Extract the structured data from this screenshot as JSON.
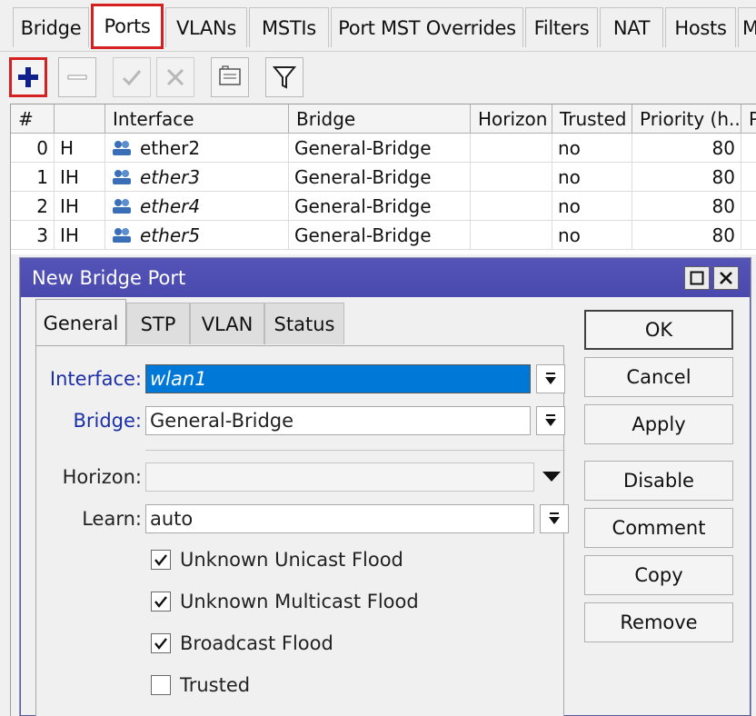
{
  "tabs": [
    "Bridge",
    "Ports",
    "VLANs",
    "MSTIs",
    "Port MST Overrides",
    "Filters",
    "NAT",
    "Hosts",
    "M"
  ],
  "active_tab": "Ports",
  "toolbar": {
    "icons": [
      "plus-icon",
      "minus-icon",
      "check-icon",
      "cross-icon",
      "note-icon",
      "filter-icon"
    ]
  },
  "table": {
    "headers": [
      "#",
      "",
      "Interface",
      "Bridge",
      "Horizon",
      "Trusted",
      "Priority (h...",
      "P"
    ],
    "rows": [
      {
        "num": "0",
        "flags": "H",
        "interface": "ether2",
        "bridge": "General-Bridge",
        "horizon": "",
        "trusted": "no",
        "priority": "80"
      },
      {
        "num": "1",
        "flags": "IH",
        "interface": "ether3",
        "bridge": "General-Bridge",
        "horizon": "",
        "trusted": "no",
        "priority": "80"
      },
      {
        "num": "2",
        "flags": "IH",
        "interface": "ether4",
        "bridge": "General-Bridge",
        "horizon": "",
        "trusted": "no",
        "priority": "80"
      },
      {
        "num": "3",
        "flags": "IH",
        "interface": "ether5",
        "bridge": "General-Bridge",
        "horizon": "",
        "trusted": "no",
        "priority": "80"
      }
    ]
  },
  "dialog": {
    "title": "New Bridge Port",
    "tabs": [
      "General",
      "STP",
      "VLAN",
      "Status"
    ],
    "active_tab": "General",
    "fields": {
      "interface_label": "Interface:",
      "interface_value": "wlan1",
      "bridge_label": "Bridge:",
      "bridge_value": "General-Bridge",
      "horizon_label": "Horizon:",
      "horizon_value": "",
      "learn_label": "Learn:",
      "learn_value": "auto"
    },
    "checkboxes": [
      {
        "label": "Unknown Unicast Flood",
        "checked": true
      },
      {
        "label": "Unknown Multicast Flood",
        "checked": true
      },
      {
        "label": "Broadcast Flood",
        "checked": true
      },
      {
        "label": "Trusted",
        "checked": false
      }
    ],
    "buttons": [
      "OK",
      "Cancel",
      "Apply",
      "Disable",
      "Comment",
      "Copy",
      "Remove"
    ]
  },
  "colors": {
    "highlight": "#d42020",
    "titlebar": "#4d4db2",
    "selection": "#0078d7",
    "label_blue": "#1a2fa8"
  }
}
